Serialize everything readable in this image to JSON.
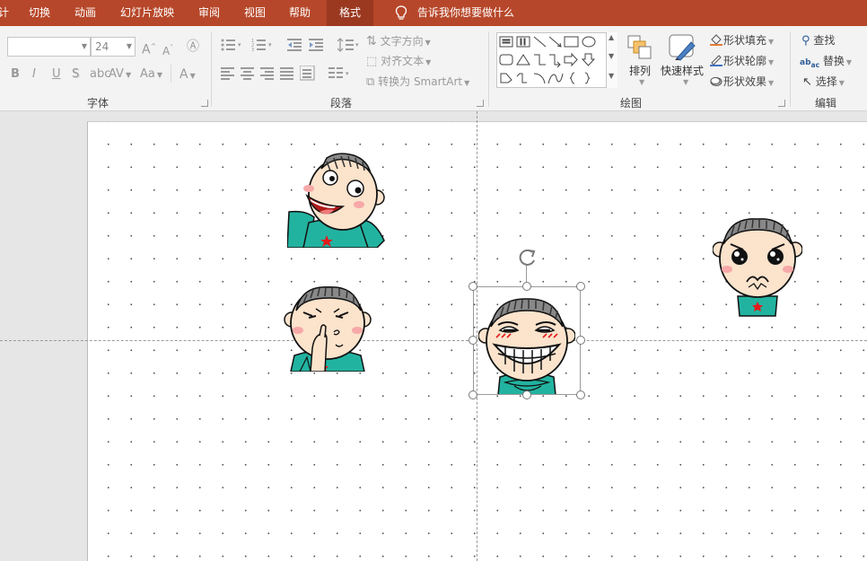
{
  "menubar": {
    "tabs": [
      "计",
      "切换",
      "动画",
      "幻灯片放映",
      "审阅",
      "视图",
      "帮助"
    ],
    "active_tab": "格式",
    "tell_me": "告诉我你想要做什么",
    "bg_color": "#b7472a"
  },
  "font_group": {
    "font_name": "",
    "font_size": "24",
    "label": "字体",
    "bold": "B",
    "italic": "I",
    "underline": "U",
    "shadow": "S",
    "spacing": "AV",
    "case": "Aa",
    "color": "A",
    "grow": "A",
    "shrink": "A"
  },
  "paragraph_group": {
    "label": "段落",
    "text_direction": "文字方向",
    "align_text": "对齐文本",
    "convert_smartart": "转换为 SmartArt"
  },
  "drawing_group": {
    "label": "绘图",
    "arrange": "排列",
    "quick_styles": "快速样式",
    "shape_fill": "形状填充",
    "shape_outline": "形状轮廓",
    "shape_effects": "形状效果"
  },
  "editing_group": {
    "label": "编辑",
    "find": "查找",
    "replace": "替换",
    "select": "选择"
  }
}
